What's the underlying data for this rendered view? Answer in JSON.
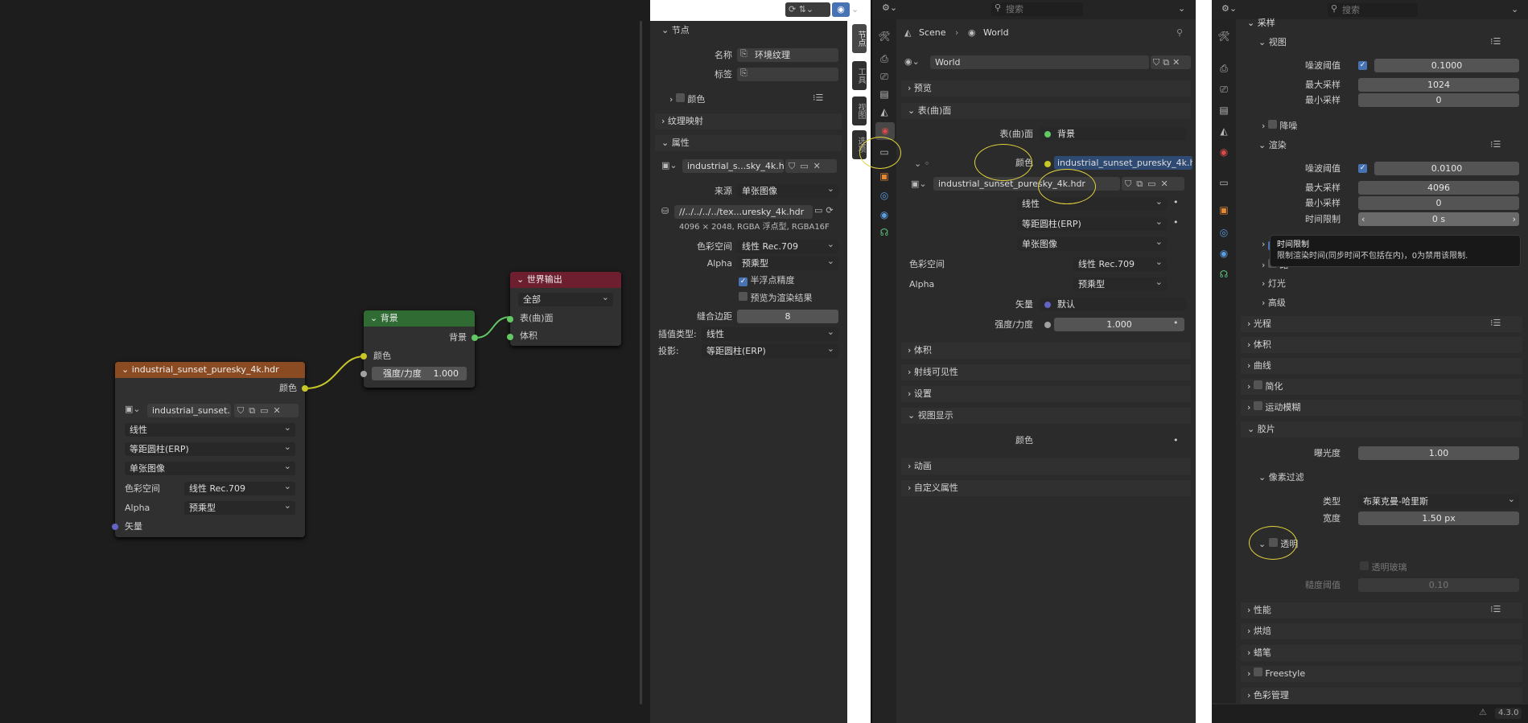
{
  "node_editor": {
    "image_node": {
      "title": "industrial_sunset_puresky_4k.hdr",
      "out_color": "颜色",
      "image_name": "industrial_sunset...",
      "interp": "线性",
      "projection": "等距圆柱(ERP)",
      "source": "单张图像",
      "colorspace_label": "色彩空间",
      "colorspace": "线性 Rec.709",
      "alpha_label": "Alpha",
      "alpha": "预乘型",
      "vector": "矢量"
    },
    "bg_node": {
      "title": "背景",
      "out": "背景",
      "in_color": "颜色",
      "strength_label": "强度/力度",
      "strength": "1.000"
    },
    "world_node": {
      "title": "世界输出",
      "target": "全部",
      "in_surface": "表(曲)面",
      "in_volume": "体积"
    }
  },
  "n_panel": {
    "node_header": "节点",
    "name_label": "名称",
    "name_value": "环境纹理",
    "label_label": "标签",
    "color_label": "颜色",
    "tex_mapping": "纹理映射",
    "props_header": "属性",
    "image_name": "industrial_s...sky_4k.hdr",
    "source_label": "来源",
    "source": "单张图像",
    "path": "//../../../../tex...uresky_4k.hdr",
    "info": "4096 × 2048,  RGBA 浮点型, RGBA16F",
    "colorspace_label": "色彩空间",
    "colorspace": "线性 Rec.709",
    "alpha_label": "Alpha",
    "alpha": "预乘型",
    "half_float": "半浮点精度",
    "preview_render": "预览为渲染结果",
    "edge_label": "缝合边距",
    "edge_value": "8",
    "interp_label": "插值类型:",
    "interp": "线性",
    "proj_label": "投影:",
    "proj": "等距圆柱(ERP)",
    "tabs": [
      "节点",
      "工具",
      "视图",
      "选项"
    ]
  },
  "world_props": {
    "search_placeholder": "搜索",
    "breadcrumb_scene": "Scene",
    "breadcrumb_world": "World",
    "world_name": "World",
    "preview": "预览",
    "surface_header": "表(曲)面",
    "surface_label": "表(曲)面",
    "surface_value": "背景",
    "color_label": "颜色",
    "color_value": "industrial_sunset_puresky_4k.h...",
    "image_name": "industrial_sunset_puresky_4k.hdr",
    "interp": "线性",
    "projection": "等距圆柱(ERP)",
    "source": "单张图像",
    "colorspace_label": "色彩空间",
    "colorspace": "线性 Rec.709",
    "alpha_label": "Alpha",
    "alpha": "预乘型",
    "vector_label": "矢量",
    "vector_value": "默认",
    "strength_label": "强度/力度",
    "strength": "1.000",
    "volume": "体积",
    "ray_visibility": "射线可见性",
    "settings": "设置",
    "viewport_display": "视图显示",
    "vd_color": "颜色",
    "animation": "动画",
    "custom_props": "自定义属性"
  },
  "render_props": {
    "search_placeholder": "搜索",
    "sampling": "采样",
    "viewport": "视图",
    "noise_threshold_label": "噪波阈值",
    "vp_noise": "0.1000",
    "max_samples_label": "最大采样",
    "vp_max": "1024",
    "min_samples_label": "最小采样",
    "vp_min": "0",
    "denoise": "降噪",
    "render": "渲染",
    "r_noise": "0.0100",
    "r_max": "4096",
    "r_min": "0",
    "time_limit_label": "时间限制",
    "time_limit": "0 s",
    "tooltip_title": "时间限制",
    "tooltip_body": "限制渲染时间(同步时间不包括在内)，0为禁用该限制.",
    "denoise2": "降",
    "path": "路",
    "lights": "灯光",
    "advanced": "高级",
    "light_paths": "光程",
    "volumes": "体积",
    "curves": "曲线",
    "simplify": "简化",
    "motion_blur": "运动模糊",
    "film": "胶片",
    "exposure_label": "曝光度",
    "exposure": "1.00",
    "pixel_filter": "像素过滤",
    "type_label": "类型",
    "type_value": "布莱克曼-哈里斯",
    "width_label": "宽度",
    "width_value": "1.50 px",
    "transparent": "透明",
    "transparent_glass": "透明玻璃",
    "roughness_label": "糙度阈值",
    "roughness": "0.10",
    "performance": "性能",
    "bake": "烘焙",
    "grease_pencil": "蜡笔",
    "freestyle": "Freestyle",
    "color_management": "色彩管理",
    "version": "4.3.0"
  },
  "colors": {
    "image_node_header": "#8a4b22",
    "bg_node_header": "#2f6b33",
    "world_node_header": "#6e1f2f",
    "socket_color": "#c7c729",
    "socket_float": "#a1a1a1",
    "socket_vector": "#6363c7",
    "socket_shader": "#63c763",
    "highlight": "#e2d33b",
    "accent": "#4772b3"
  }
}
